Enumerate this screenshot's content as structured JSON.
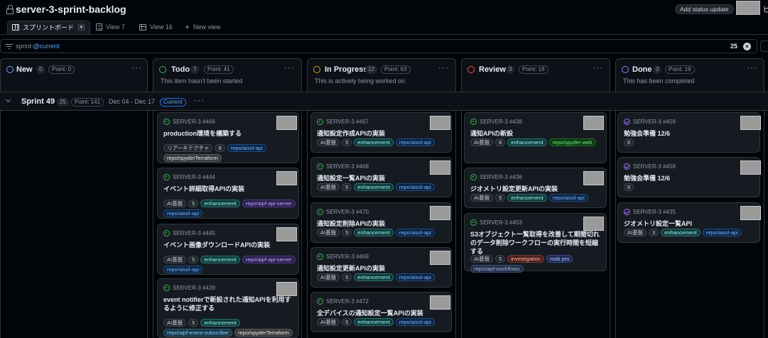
{
  "app": {
    "title": "server-3-sprint-backlog",
    "status_button": "Add status update",
    "edge_glyph": "ヒ"
  },
  "tabs": [
    {
      "label": "スプリントボード"
    },
    {
      "label": "View 7"
    },
    {
      "label": "View 16"
    },
    {
      "label": "New view"
    }
  ],
  "filter": {
    "prefix": "sprint:",
    "query": "@current",
    "count": "25",
    "clear": "×"
  },
  "columns": [
    {
      "name": "New",
      "count": "0",
      "points": "Point: 0",
      "desc": "",
      "color": "#58a6ff"
    },
    {
      "name": "Todo",
      "count": "7",
      "points": "Point: 41",
      "desc": "This item hasn't been started",
      "color": "#3fb950"
    },
    {
      "name": "In Progress",
      "count": "12",
      "points": "Point: 63",
      "desc": "This is actively being worked on",
      "color": "#d29922"
    },
    {
      "name": "Review",
      "count": "3",
      "points": "Point: 18",
      "desc": "",
      "color": "#f85149"
    },
    {
      "name": "Done",
      "count": "3",
      "points": "Point: 19",
      "desc": "This has been completed",
      "color": "#a371f7"
    }
  ],
  "sprint": {
    "name": "Sprint 49",
    "count": "25",
    "points": "Point: 141",
    "dates": "Dec 04 - Dec 17",
    "current": "Current",
    "more": "···"
  },
  "more": "···",
  "cards": {
    "todo": [
      {
        "ref": "SERVER-3 #466",
        "title": "production環境を構築する",
        "labels": [
          [
            "リアーキテクチャ",
            "plain"
          ],
          [
            "8",
            "num"
          ],
          [
            "repo/aisol-api",
            "aisol"
          ],
          [
            "repo/spyderTerraform",
            "terra"
          ]
        ]
      },
      {
        "ref": "SERVER-3 #444",
        "title": "イベント詳細取得APIの実装",
        "labels": [
          [
            "AI基盤",
            "plain"
          ],
          [
            "5",
            "num"
          ],
          [
            "enhancement",
            "enh"
          ],
          [
            "repo/aipf-api-server",
            "aipf"
          ],
          [
            "repo/aisol-api",
            "aisol"
          ]
        ]
      },
      {
        "ref": "SERVER-3 #445",
        "title": "イベント画像ダウンロードAPIの実装",
        "labels": [
          [
            "AI基盤",
            "plain"
          ],
          [
            "5",
            "num"
          ],
          [
            "enhancement",
            "enh"
          ],
          [
            "repo/aipf-api-server",
            "aipf"
          ],
          [
            "repo/aisol-api",
            "aisol"
          ]
        ]
      },
      {
        "ref": "SERVER-3 #439",
        "title": "event notifierで新設された通知APIを利用するように修正する",
        "labels": [
          [
            "AI基盤",
            "plain"
          ],
          [
            "5",
            "num"
          ],
          [
            "enhancement",
            "enh"
          ],
          [
            "repo/aipf-event-subscriber",
            "sub"
          ],
          [
            "repo/spyderTerraform",
            "terra"
          ]
        ]
      }
    ],
    "progress": [
      {
        "ref": "SERVER-3 #467",
        "title": "通知設定作成APIの実装",
        "labels": [
          [
            "AI基盤",
            "plain"
          ],
          [
            "5",
            "num"
          ],
          [
            "enhancement",
            "enh"
          ],
          [
            "repo/aisol-api",
            "aisol"
          ]
        ]
      },
      {
        "ref": "SERVER-3 #468",
        "title": "通知設定一覧APIの実装",
        "labels": [
          [
            "AI基盤",
            "plain"
          ],
          [
            "5",
            "num"
          ],
          [
            "enhancement",
            "enh"
          ],
          [
            "repo/aisol-api",
            "aisol"
          ]
        ]
      },
      {
        "ref": "SERVER-3 #470",
        "title": "通知設定削除APIの実装",
        "labels": [
          [
            "AI基盤",
            "plain"
          ],
          [
            "5",
            "num"
          ],
          [
            "enhancement",
            "enh"
          ],
          [
            "repo/aisol-api",
            "aisol"
          ]
        ]
      },
      {
        "ref": "SERVER-3 #469",
        "title": "通知設定更新APIの実装",
        "labels": [
          [
            "AI基盤",
            "plain"
          ],
          [
            "5",
            "num"
          ],
          [
            "enhancement",
            "enh"
          ],
          [
            "repo/aisol-api",
            "aisol"
          ]
        ]
      },
      {
        "ref": "SERVER-3 #472",
        "title": "全デバイスの通知設定一覧APIの実装",
        "labels": [
          [
            "AI基盤",
            "plain"
          ],
          [
            "5",
            "num"
          ],
          [
            "enhancement",
            "enh"
          ],
          [
            "repo/aisol-api",
            "aisol"
          ]
        ]
      }
    ],
    "review": [
      {
        "ref": "SERVER-3 #438",
        "title": "通知APIの新設",
        "labels": [
          [
            "AI基盤",
            "plain"
          ],
          [
            "8",
            "num"
          ],
          [
            "enhancement",
            "enh"
          ],
          [
            "repo/spyder-web",
            "web"
          ]
        ]
      },
      {
        "ref": "SERVER-3 #436",
        "title": "ジオメトリ設定更新APIの実装",
        "labels": [
          [
            "AI基盤",
            "plain"
          ],
          [
            "5",
            "num"
          ],
          [
            "enhancement",
            "enh"
          ],
          [
            "repo/aisol-api",
            "aisol"
          ]
        ]
      },
      {
        "ref": "SERVER-3 #453",
        "title": "S3オブジェクト一覧取得を改善して期間切れのデータ削除ワークフローの実行時間を短縮する",
        "labels": [
          [
            "AI基盤",
            "plain"
          ],
          [
            "5",
            "num"
          ],
          [
            "investigation",
            "invest"
          ],
          [
            "mob pro",
            "mob"
          ],
          [
            "repo/aipf-workflows",
            "wf"
          ]
        ]
      }
    ],
    "done": [
      {
        "ref": "SERVER-3 #459",
        "title": "勉強会準備 12/6",
        "labels": [
          [
            "8",
            "num"
          ]
        ]
      },
      {
        "ref": "SERVER-3 #458",
        "title": "勉強会準備 12/6",
        "labels": [
          [
            "8",
            "num"
          ]
        ]
      },
      {
        "ref": "SERVER-3 #435",
        "title": "ジオメトリ設定一覧API",
        "labels": [
          [
            "AI基盤",
            "plain"
          ],
          [
            "3",
            "num"
          ],
          [
            "enhancement",
            "enh"
          ],
          [
            "repo/aisol-api",
            "aisol"
          ]
        ]
      }
    ]
  }
}
